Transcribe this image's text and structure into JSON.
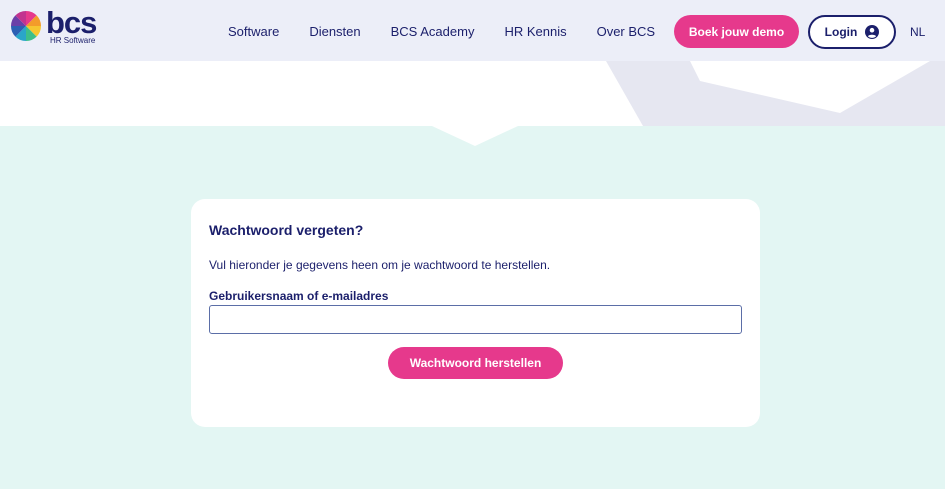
{
  "logo": {
    "word": "bcs",
    "subtitle": "HR Software"
  },
  "nav": {
    "items": [
      {
        "label": "Software"
      },
      {
        "label": "Diensten"
      },
      {
        "label": "BCS Academy"
      },
      {
        "label": "HR Kennis"
      },
      {
        "label": "Over BCS"
      }
    ]
  },
  "header": {
    "demo_label": "Boek jouw demo",
    "login_label": "Login",
    "lang_label": "NL"
  },
  "card": {
    "title": "Wachtwoord vergeten?",
    "description": "Vul hieronder je gegevens heen om je wachtwoord te herstellen.",
    "field_label": "Gebruikersnaam of e-mailadres",
    "field_value": "",
    "button_label": "Wachtwoord herstellen"
  },
  "colors": {
    "brand_navy": "#1b1f6b",
    "accent_pink": "#e6398c",
    "header_bg": "#eceef8",
    "page_bg": "#e3f6f3"
  },
  "icons": {
    "login": "user-circle-icon",
    "logo": "color-wheel-icon"
  }
}
